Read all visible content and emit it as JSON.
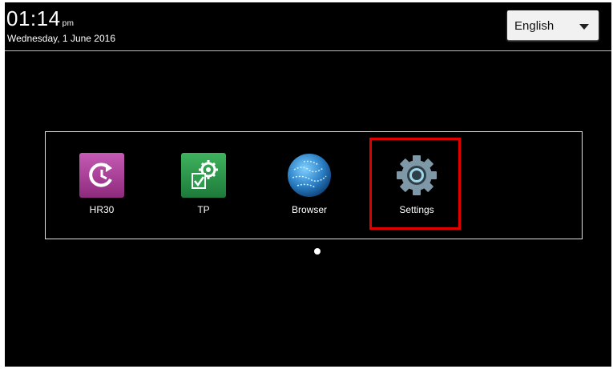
{
  "status_bar": {
    "time": "01:14",
    "ampm": "pm",
    "date": "Wednesday, 1 June 2016"
  },
  "language_selector": {
    "selected": "English",
    "icon": "chevron-down-icon"
  },
  "apps": [
    {
      "label": "HR30",
      "icon": "hr30-refresh-icon",
      "color": "#b0449e"
    },
    {
      "label": "TP",
      "icon": "tp-gear-check-icon",
      "color": "#2e9e4f"
    },
    {
      "label": "Browser",
      "icon": "globe-icon",
      "color": "#2a7fc4"
    },
    {
      "label": "Settings",
      "icon": "settings-gear-icon",
      "color": "#8aa0ae"
    }
  ],
  "highlight": {
    "target": "Settings",
    "color": "#e00000"
  },
  "pager": {
    "pages": 1,
    "current": 1
  }
}
